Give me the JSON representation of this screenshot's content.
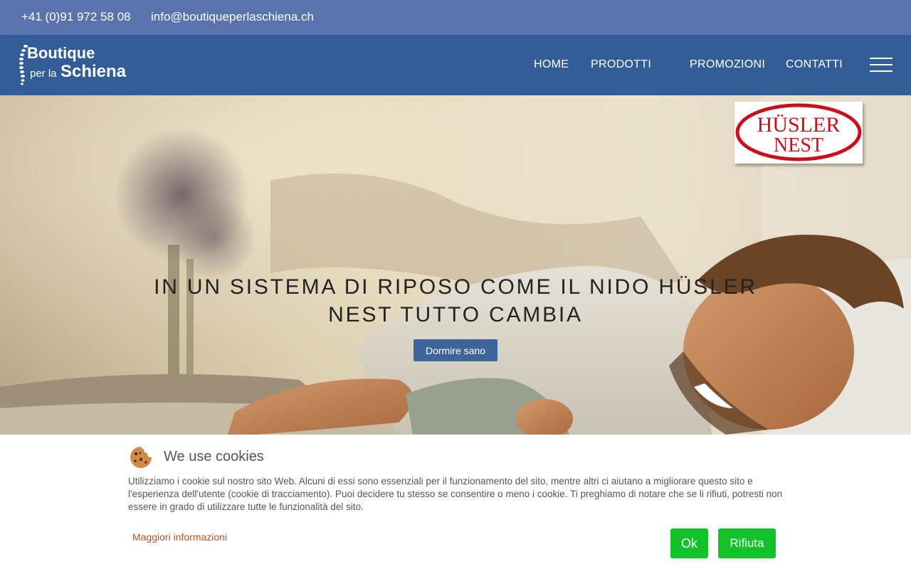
{
  "topbar": {
    "phone": "+41 (0)91 972 58 08",
    "email": "info@boutiqueperlaschiena.ch"
  },
  "logo": {
    "line1": "Boutique",
    "line2_small": "per la",
    "line2_large": "Schiena"
  },
  "nav": {
    "items": [
      {
        "label": "HOME"
      },
      {
        "label": "PRODOTTI"
      },
      {
        "label": "PROMOZIONI"
      },
      {
        "label": "CONTATTI"
      }
    ],
    "menu_icon": "hamburger-icon"
  },
  "hero": {
    "badge_line1": "HÜSLER",
    "badge_line2": "NEST",
    "title": "IN UN SISTEMA DI RIPOSO COME IL NIDO HÜSLER NEST TUTTO CAMBIA",
    "button_label": "Dormire sano"
  },
  "cookie": {
    "icon": "cookie-icon",
    "title": "We use cookies",
    "text": "Utilizziamo i cookie sul nostro sito Web. Alcuni di essi sono essenziali per il funzionamento del sito, mentre altri ci aiutano a migliorare questo sito e l'esperienza dell'utente (cookie di tracciamento). Puoi decidere tu stesso se consentire o meno i cookie. Ti preghiamo di notare che se li rifiuti, potresti non essere in grado di utilizzare tutte le funzionalità del sito.",
    "more_link": "Maggiori informazioni",
    "ok_label": "Ok",
    "reject_label": "Rifiuta"
  },
  "colors": {
    "topbar": "#5a73ad",
    "navbar": "#325d96",
    "hero_button": "#3f6499",
    "cookie_buttons": "#13c22a",
    "cookie_link": "#b5532e",
    "badge_red": "#c8101c"
  }
}
